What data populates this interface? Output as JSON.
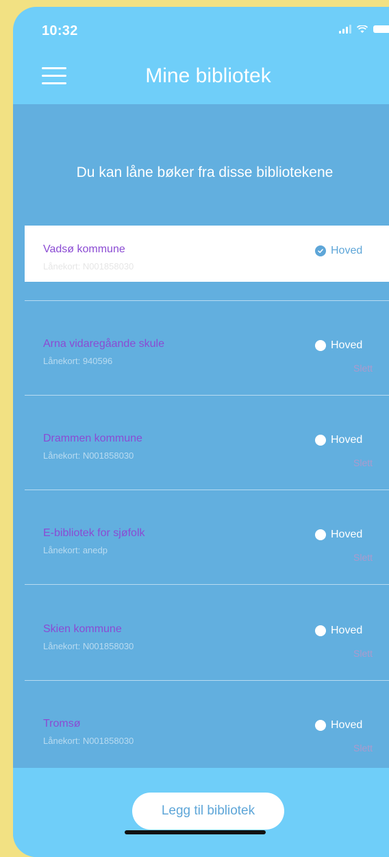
{
  "status": {
    "time": "10:32"
  },
  "header": {
    "title": "Mine bibliotek"
  },
  "intro": "Du kan låne bøker fra disse bibliotekene",
  "hoved_label": "Hoved",
  "delete_label": "Slett",
  "libraries": [
    {
      "name": "Vadsø kommune",
      "card": "Lånekort: N001858030",
      "main": true
    },
    {
      "name": "Arna vidaregåande skule",
      "card": "Lånekort: 940596",
      "main": false
    },
    {
      "name": "Drammen kommune",
      "card": "Lånekort: N001858030",
      "main": false
    },
    {
      "name": "E-bibliotek for sjøfolk",
      "card": "Lånekort: anedp",
      "main": false
    },
    {
      "name": "Skien kommune",
      "card": "Lånekort: N001858030",
      "main": false
    },
    {
      "name": "Tromsø",
      "card": "Lånekort: N001858030",
      "main": false
    }
  ],
  "add_button": "Legg til bibliotek",
  "colors": {
    "background": "#f2e183",
    "header": "#6fcef9",
    "content": "#62afdf",
    "library_name": "#8b4bd3",
    "accent": "#5ea6d8",
    "delete": "#e88abf"
  }
}
